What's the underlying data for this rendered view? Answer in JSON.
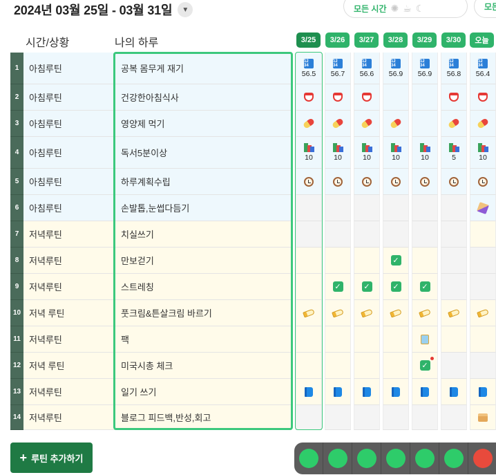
{
  "header": {
    "title": "2024년 03월 25일 - 03월 31일",
    "dropdown_icon": "▼",
    "time_filter": "모든 시간",
    "time_filter_2": "모든"
  },
  "columns": {
    "time_status": "시간/상황",
    "my_day": "나의 하루"
  },
  "dates": [
    "3/25",
    "3/26",
    "3/27",
    "3/28",
    "3/29",
    "3/30",
    "오늘"
  ],
  "routines": [
    {
      "num": "1",
      "category": "아침루틴",
      "task": "공복 몸무게 재기"
    },
    {
      "num": "2",
      "category": "아침루틴",
      "task": "건강한아침식사"
    },
    {
      "num": "3",
      "category": "아침루틴",
      "task": "영양제 먹기"
    },
    {
      "num": "4",
      "category": "아침루틴",
      "task": "독서5분이상"
    },
    {
      "num": "5",
      "category": "아침루틴",
      "task": "하루계획수립"
    },
    {
      "num": "6",
      "category": "아침루틴",
      "task": "손발톱,눈썹다듬기"
    },
    {
      "num": "7",
      "category": "저녁루틴",
      "task": "치실쓰기"
    },
    {
      "num": "8",
      "category": "저녁루틴",
      "task": "만보걷기"
    },
    {
      "num": "9",
      "category": "저녁루틴",
      "task": "스트레칭"
    },
    {
      "num": "10",
      "category": "저녁 루틴",
      "task": "풋크림&튼살크림 바르기"
    },
    {
      "num": "11",
      "category": "저녁루틴",
      "task": "팩"
    },
    {
      "num": "12",
      "category": "저녁 루틴",
      "task": "미국시총 체크"
    },
    {
      "num": "13",
      "category": "저녁루틴",
      "task": "일기 쓰기"
    },
    {
      "num": "14",
      "category": "저녁루틴",
      "task": "블로그 피드백,반성,회고"
    }
  ],
  "weights": [
    "56.5",
    "56.7",
    "56.6",
    "56.9",
    "56.9",
    "56.8",
    "56.4"
  ],
  "reading_minutes": [
    "10",
    "10",
    "10",
    "10",
    "10",
    "5",
    "10"
  ],
  "icons": {
    "weight": "numbers-1234-icon",
    "meal": "rice-bowl-icon",
    "supplement": "pill-icon",
    "reading": "books-icon",
    "planning": "clock-icon",
    "nails": "nail-polish-icon",
    "check": "check-icon",
    "cream": "cream-tube-icon",
    "mask": "face-pack-icon",
    "diary": "blue-book-icon",
    "blog": "box-icon"
  },
  "add_button": "루틴 추가하기",
  "colors": {
    "accent": "#2fb36a",
    "row_header": "#4a6b5a",
    "morning_bg": "#eef8fd",
    "evening_bg": "#fffbea",
    "done": "#2ecc6a",
    "not_done": "#e84a3c"
  },
  "daily_status": [
    "done",
    "done",
    "done",
    "done",
    "done",
    "done",
    "not_done"
  ]
}
